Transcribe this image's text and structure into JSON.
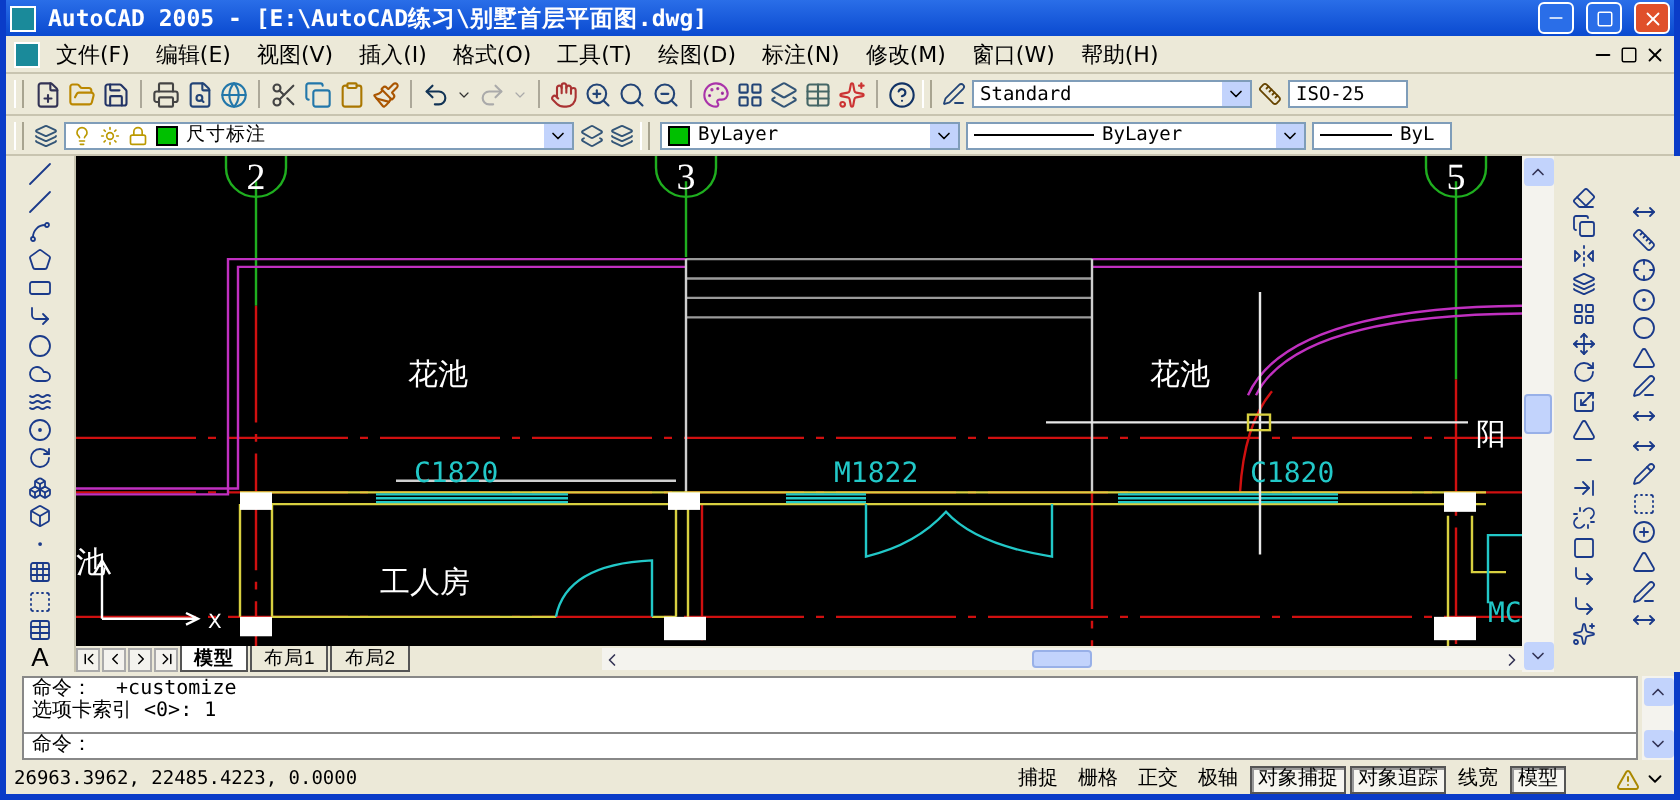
{
  "window": {
    "title": "AutoCAD 2005 - [E:\\AutoCAD练习\\别墅首层平面图.dwg]"
  },
  "menu": [
    {
      "label": "文件(F)"
    },
    {
      "label": "编辑(E)"
    },
    {
      "label": "视图(V)"
    },
    {
      "label": "插入(I)"
    },
    {
      "label": "格式(O)"
    },
    {
      "label": "工具(T)"
    },
    {
      "label": "绘图(D)"
    },
    {
      "label": "标注(N)"
    },
    {
      "label": "修改(M)"
    },
    {
      "label": "窗口(W)"
    },
    {
      "label": "帮助(H)"
    }
  ],
  "toolbars": {
    "text_style": "Standard",
    "dim_style": "ISO-25",
    "layer": "尺寸标注",
    "color_control": "ByLayer",
    "linetype": "ByLayer",
    "lineweight": "ByL"
  },
  "draw_toolbar": {
    "text_tool": "A"
  },
  "drawing": {
    "axis_labels": [
      "2",
      "3",
      "5"
    ],
    "labels": [
      {
        "text": "花池",
        "color": "#ffffff"
      },
      {
        "text": "花池",
        "color": "#ffffff"
      },
      {
        "text": "C1820",
        "color": "#22c8c8"
      },
      {
        "text": "M1822",
        "color": "#22c8c8"
      },
      {
        "text": "C1820",
        "color": "#22c8c8"
      },
      {
        "text": "工人房",
        "color": "#ffffff"
      },
      {
        "text": "阳",
        "color": "#ffffff"
      },
      {
        "text": "池",
        "color": "#ffffff"
      },
      {
        "text": "MC",
        "color": "#22c8c8"
      }
    ],
    "ucs_axis": "X"
  },
  "layout_tabs": [
    {
      "label": "模型",
      "selected": true
    },
    {
      "label": "布局1",
      "selected": false
    },
    {
      "label": "布局2",
      "selected": false
    }
  ],
  "command": {
    "lines": [
      "命令：  +customize",
      "选项卡索引 <0>: 1"
    ],
    "prompt": "命令："
  },
  "status_bar": {
    "coordinates": "26963.3962, 22485.4223, 0.0000",
    "buttons": [
      {
        "label": "捕捉",
        "on": false
      },
      {
        "label": "栅格",
        "on": false
      },
      {
        "label": "正交",
        "on": false
      },
      {
        "label": "极轴",
        "on": false
      },
      {
        "label": "对象捕捉",
        "on": true
      },
      {
        "label": "对象追踪",
        "on": true
      },
      {
        "label": "线宽",
        "on": false
      },
      {
        "label": "模型",
        "on": true
      }
    ]
  }
}
